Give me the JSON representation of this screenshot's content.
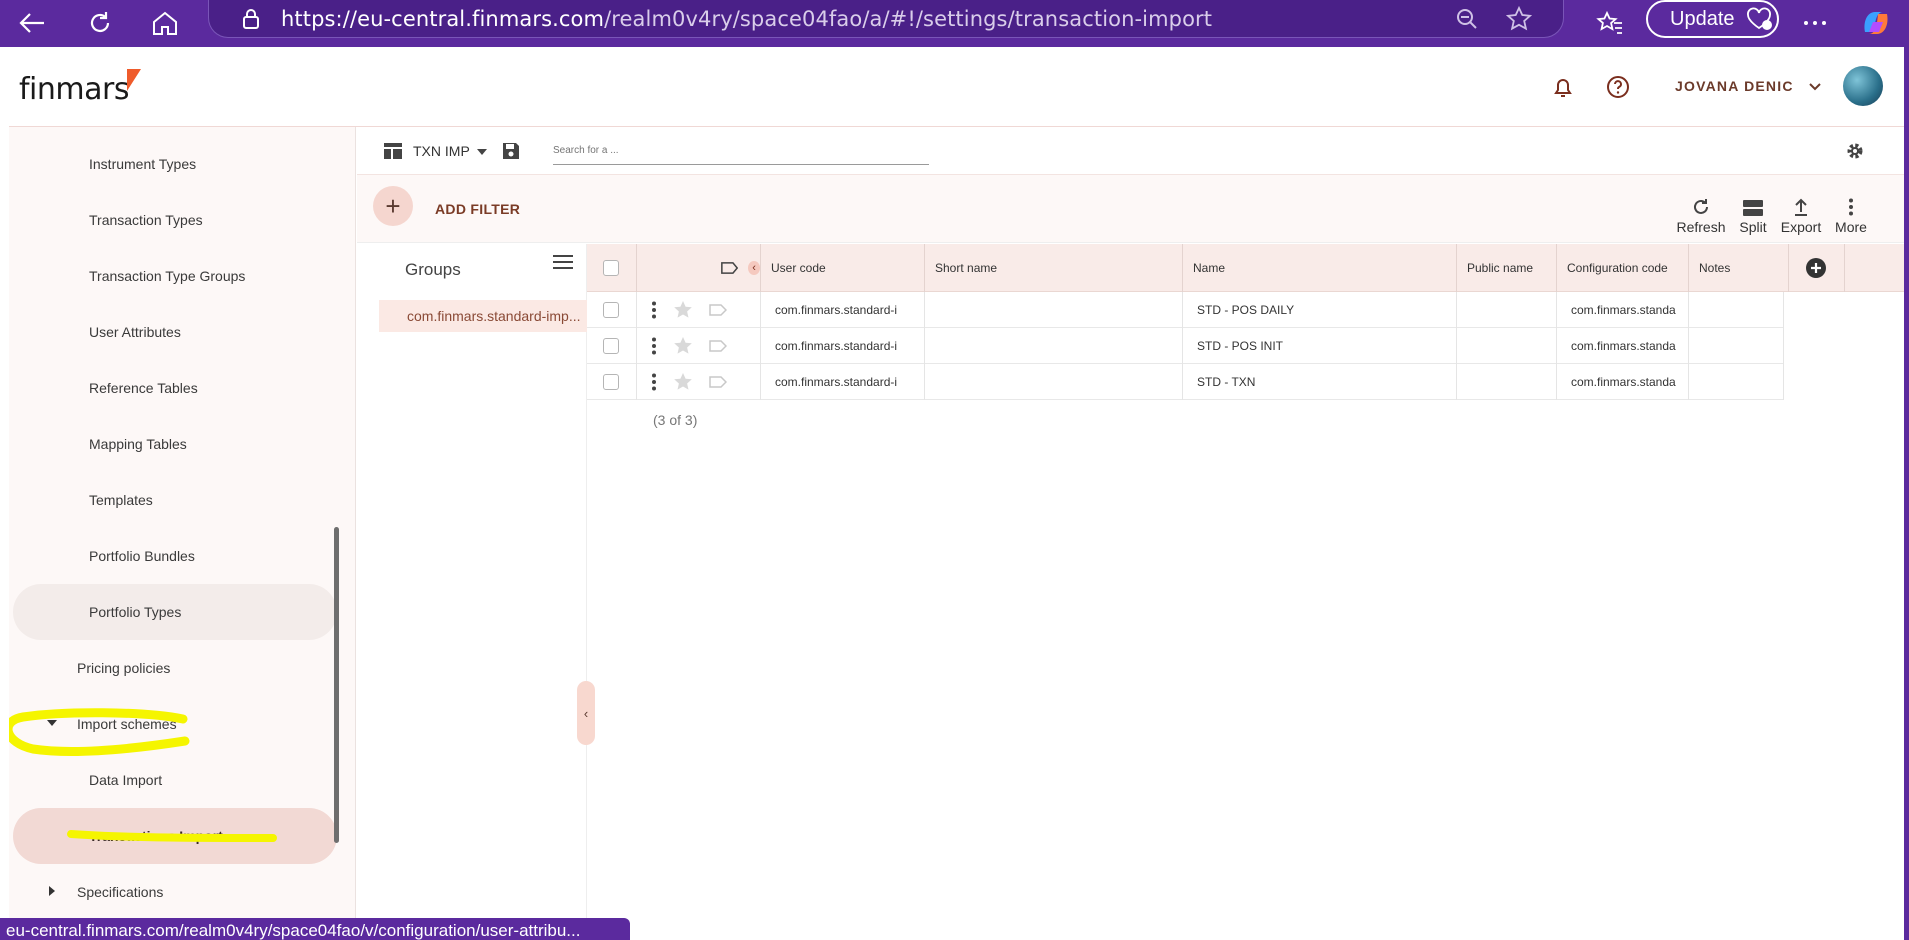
{
  "browser": {
    "url_host": "https://eu-central.finmars.com",
    "url_path": "/realm0v4ry/space04fao/a/#!/settings/transaction-import",
    "update_label": "Update",
    "status_url": "eu-central.finmars.com/realm0v4ry/space04fao/v/configuration/user-attribu..."
  },
  "header": {
    "logo": "finmars",
    "user_name": "JOVANA DENIC"
  },
  "sidebar": {
    "items": [
      {
        "label": "Instrument Types"
      },
      {
        "label": "Transaction Types"
      },
      {
        "label": "Transaction Type Groups"
      },
      {
        "label": "User Attributes"
      },
      {
        "label": "Reference Tables"
      },
      {
        "label": "Mapping Tables"
      },
      {
        "label": "Templates"
      },
      {
        "label": "Portfolio Bundles"
      },
      {
        "label": "Portfolio Types"
      },
      {
        "label": "Pricing policies"
      },
      {
        "label": "Import schemes"
      },
      {
        "label": "Data Import"
      },
      {
        "label": "Transactions Import"
      },
      {
        "label": "Specifications"
      }
    ]
  },
  "toolbar": {
    "layout_name": "TXN IMP",
    "search_placeholder": "Search for a ...",
    "add_filter": "ADD FILTER",
    "refresh": "Refresh",
    "split": "Split",
    "export": "Export",
    "more": "More"
  },
  "groups": {
    "title": "Groups",
    "items": [
      "com.finmars.standard-imp..."
    ]
  },
  "table": {
    "columns": [
      "User code",
      "Short name",
      "Name",
      "Public name",
      "Configuration code",
      "Notes"
    ],
    "rows": [
      {
        "user_code": "com.finmars.standard-i",
        "short_name": "",
        "name": "STD - POS DAILY",
        "public_name": "",
        "config_code": "com.finmars.standa",
        "notes": ""
      },
      {
        "user_code": "com.finmars.standard-i",
        "short_name": "",
        "name": "STD - POS INIT",
        "public_name": "",
        "config_code": "com.finmars.standa",
        "notes": ""
      },
      {
        "user_code": "com.finmars.standard-i",
        "short_name": "",
        "name": "STD - TXN",
        "public_name": "",
        "config_code": "com.finmars.standa",
        "notes": ""
      }
    ],
    "count": "(3 of 3)"
  },
  "colors": {
    "browser": "#5b2a9e",
    "accent": "#ef5b2b",
    "active_item": "#f2d9d4",
    "highlight": "#f5f500"
  }
}
